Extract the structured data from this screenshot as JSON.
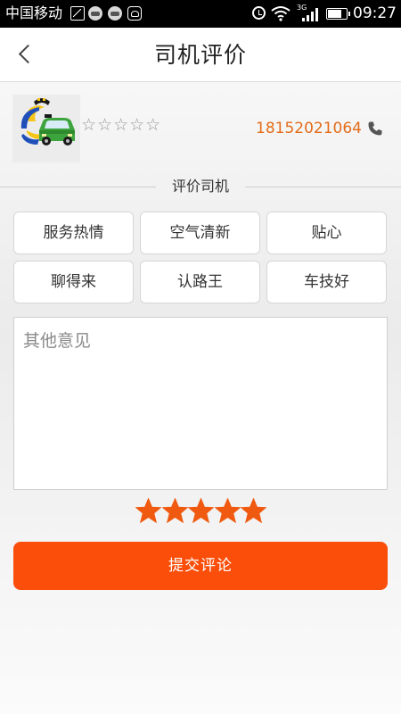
{
  "status_bar": {
    "carrier": "中国移动",
    "network": "3G",
    "time": "09:27",
    "battery_level": 0.7
  },
  "header": {
    "title": "司机评价"
  },
  "driver": {
    "rating_stars": "☆☆☆☆☆",
    "phone": "18152021064"
  },
  "section": {
    "label": "评价司机"
  },
  "tags": [
    "服务热情",
    "空气清新",
    "贴心",
    "聊得来",
    "认路王",
    "车技好"
  ],
  "comment": {
    "placeholder": "其他意见",
    "value": ""
  },
  "rating": {
    "value": 5,
    "max": 5
  },
  "submit": {
    "label": "提交评论"
  },
  "colors": {
    "accent": "#fa4e0a",
    "phone": "#e36c19",
    "star": "#f05a10"
  }
}
